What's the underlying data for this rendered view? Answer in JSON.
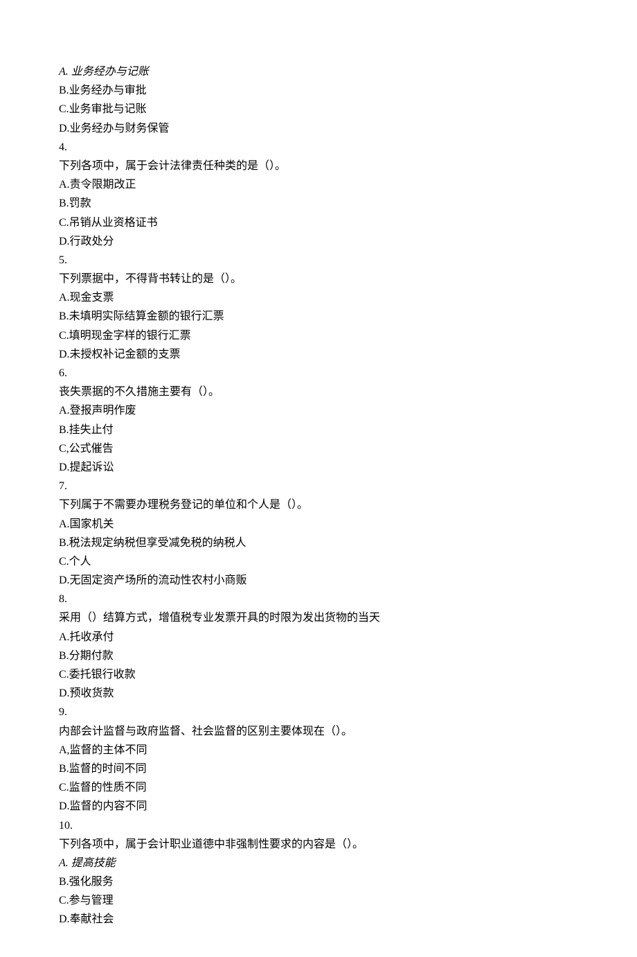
{
  "q3": {
    "optA": "A. 业务经办与记账",
    "optB": "B.业务经办与审批",
    "optC": "C.业务审批与记账",
    "optD": "D.业务经办与财务保管"
  },
  "q4": {
    "num": "4.",
    "stem": "下列各项中，属于会计法律责任种类的是（）。",
    "optA": "A.责令限期改正",
    "optB": "B.罚款",
    "optC": "C.吊销从业资格证书",
    "optD": "D.行政处分"
  },
  "q5": {
    "num": "5.",
    "stem": "下列票据中，不得背书转让的是（）。",
    "optA": "A.现金支票",
    "optB": "B.未填明实际结算金额的银行汇票",
    "optC": "C.填明现金字样的银行汇票",
    "optD": "D.未授权补记金额的支票"
  },
  "q6": {
    "num": "6.",
    "stem": "丧失票据的不久措施主要有（）。",
    "optA": "A.登报声明作废",
    "optB": "B.挂失止付",
    "optC": "C,公式催告",
    "optD": "D.提起诉讼"
  },
  "q7": {
    "num": "7.",
    "stem": "下列属于不需要办理税务登记的单位和个人是（）。",
    "optA": "A.国家机关",
    "optB": "B.税法规定纳税但享受减免税的纳税人",
    "optC": "C.个人",
    "optD": "D.无固定资产场所的流动性农村小商贩"
  },
  "q8": {
    "num": "8.",
    "stem": "采用（）结算方式，增值税专业发票开具的时限为发出货物的当天",
    "optA": "A.托收承付",
    "optB": "B.分期付款",
    "optC": "C.委托银行收款",
    "optD": "D.预收货款"
  },
  "q9": {
    "num": "9.",
    "stem": "内部会计监督与政府监督、社会监督的区别主要体现在（）。",
    "optA": "A,监督的主体不同",
    "optB": "B.监督的时间不同",
    "optC": "C.监督的性质不同",
    "optD": "D.监督的内容不同"
  },
  "q10": {
    "num": "10.",
    "stem": "下列各项中，属于会计职业道德中非强制性要求的内容是（）。",
    "optA": "A. 提高技能",
    "optB": "B.强化服务",
    "optC": "C.参与管理",
    "optD": "D.奉献社会"
  }
}
